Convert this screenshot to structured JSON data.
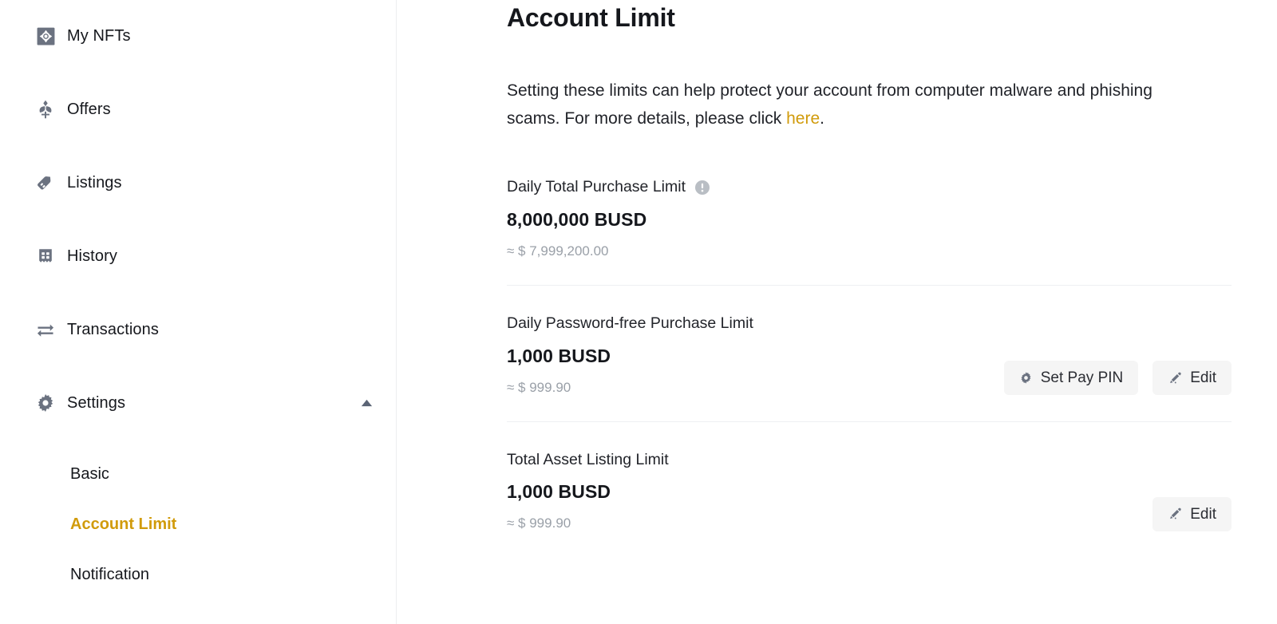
{
  "sidebar": {
    "items": [
      {
        "id": "my-nfts",
        "label": "My NFTs",
        "icon": "nft-icon"
      },
      {
        "id": "offers",
        "label": "Offers",
        "icon": "offers-flower-icon"
      },
      {
        "id": "listings",
        "label": "Listings",
        "icon": "tag-icon"
      },
      {
        "id": "history",
        "label": "History",
        "icon": "receipt-icon"
      },
      {
        "id": "transactions",
        "label": "Transactions",
        "icon": "transfer-arrows-icon"
      },
      {
        "id": "settings",
        "label": "Settings",
        "icon": "gear-icon",
        "expanded": true,
        "caret": "caret-up-icon"
      }
    ],
    "sub_items": [
      {
        "id": "basic",
        "label": "Basic",
        "active": false
      },
      {
        "id": "account-limit",
        "label": "Account Limit",
        "active": true
      },
      {
        "id": "notification",
        "label": "Notification",
        "active": false
      }
    ],
    "accent_color": "#d19b0b",
    "icon_color": "#6b7280"
  },
  "main": {
    "title": "Account Limit",
    "intro": {
      "before_link": "Setting these limits can help protect your account from computer malware and phishing scams. For more details, please click ",
      "link_text": "here",
      "after_link": "."
    },
    "limits": [
      {
        "id": "daily-total-purchase-limit",
        "label": "Daily Total Purchase Limit",
        "has_info_icon": true,
        "amount": "8,000,000 BUSD",
        "approx": "≈ $ 7,999,200.00",
        "actions": []
      },
      {
        "id": "daily-password-free-purchase-limit",
        "label": "Daily Password-free Purchase Limit",
        "has_info_icon": false,
        "amount": "1,000 BUSD",
        "approx": "≈ $ 999.90",
        "actions": [
          {
            "id": "set-pay-pin",
            "label": "Set Pay PIN",
            "icon": "gear-icon"
          },
          {
            "id": "edit",
            "label": "Edit",
            "icon": "pencil-icon"
          }
        ]
      },
      {
        "id": "total-asset-listing-limit",
        "label": "Total Asset Listing Limit",
        "has_info_icon": false,
        "amount": "1,000 BUSD",
        "approx": "≈ $ 999.90",
        "actions": [
          {
            "id": "edit",
            "label": "Edit",
            "icon": "pencil-icon"
          }
        ]
      }
    ]
  },
  "theme": {
    "accent": "#d19b0b",
    "text_primary": "#15171c",
    "text_muted": "#9aa0a8",
    "button_bg": "#f5f5f5",
    "divider": "#eef0f2"
  }
}
